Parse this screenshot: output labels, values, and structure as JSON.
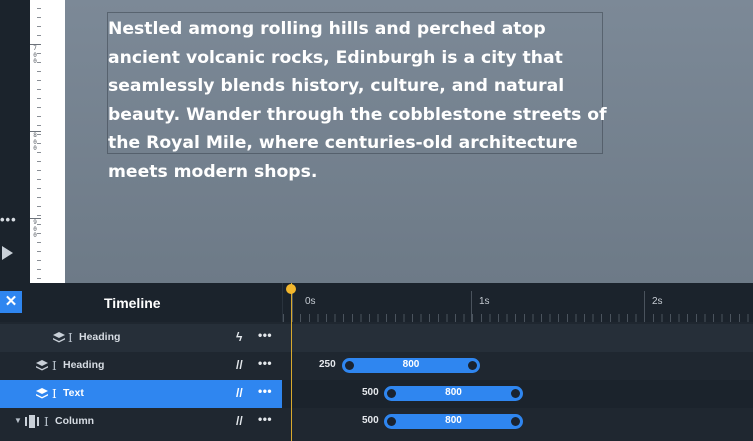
{
  "canvas": {
    "body_text": "Nestled among rolling hills and perched atop ancient volcanic rocks, Edinburgh is a city that seamlessly blends history, culture, and natural beauty. Wander through the cobblestone streets of the Royal Mile, where centuries-old architecture meets modern shops."
  },
  "ruler": {
    "labels": [
      "7\n0\n0",
      "8\n0\n0",
      "9\n0\n0"
    ]
  },
  "left_rail": {
    "more": "•••"
  },
  "timeline": {
    "close": "✕",
    "title": "Timeline",
    "time_labels": [
      "0s",
      "1s",
      "2s"
    ],
    "rows": [
      {
        "label": "Heading",
        "action_icon": "bolt-icon",
        "action_glyph": "ϟ",
        "more": "•••"
      },
      {
        "label": "Heading",
        "action_icon": "stagger-icon",
        "action_glyph": "//",
        "more": "•••",
        "delay": "250",
        "duration": "800"
      },
      {
        "label": "Text",
        "action_icon": "stagger-icon",
        "action_glyph": "//",
        "more": "•••",
        "delay": "500",
        "duration": "800",
        "selected": true
      },
      {
        "label": "Column",
        "action_icon": "stagger-icon",
        "action_glyph": "//",
        "more": "•••",
        "delay": "500",
        "duration": "800"
      }
    ]
  },
  "colors": {
    "accent": "#2f86f0",
    "playhead": "#f2b62c",
    "panel": "#1f2730"
  }
}
